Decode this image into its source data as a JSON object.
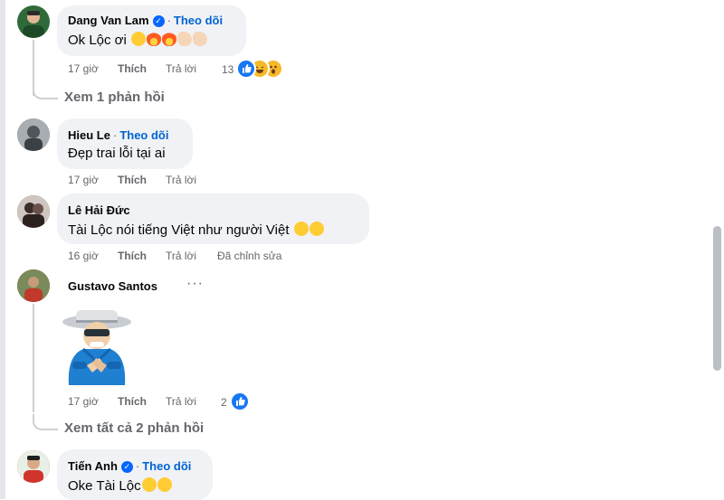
{
  "comments": [
    {
      "name": "Dang Van Lam",
      "verified": true,
      "follow": "Theo dõi",
      "text": "Ok Lộc ơi",
      "emoji_icons": [
        "crazy-face",
        "fire",
        "fire",
        "flexed-arm",
        "flexed-arm"
      ],
      "time": "17 giờ",
      "like_label": "Thích",
      "reply_label": "Trả lời",
      "reaction_count": "13",
      "reaction_icons": [
        "like",
        "haha",
        "wow"
      ],
      "replies_link": "Xem 1 phản hồi",
      "avatar_color": "#2f6b3a"
    },
    {
      "name": "Hieu Le",
      "follow": "Theo dõi",
      "text": "Đẹp trai lỗi tại ai",
      "time": "17 giờ",
      "like_label": "Thích",
      "reply_label": "Trả lời",
      "avatar_color": "#8a8f94"
    },
    {
      "name": "Lê Hải Đức",
      "text": "Tài Lộc nói tiếng Việt như người Việt",
      "emoji_icons": [
        "rolling-laugh",
        "tongue-face"
      ],
      "time": "16 giờ",
      "like_label": "Thích",
      "reply_label": "Trả lời",
      "edited_label": "Đã chỉnh sửa",
      "avatar_color": "#5a4a48"
    },
    {
      "name": "Gustavo Santos",
      "more": "···",
      "sticker": "clapping-old-man-sticker",
      "time": "17 giờ",
      "like_label": "Thích",
      "reply_label": "Trả lời",
      "reaction_count": "2",
      "reaction_icons": [
        "like"
      ],
      "replies_link": "Xem tất cả 2 phản hồi",
      "avatar_color": "#b33a2e"
    },
    {
      "name": "Tiến Anh",
      "verified": true,
      "follow": "Theo dõi",
      "text": "Oke Tài Lộc",
      "emoji_icons": [
        "rolling-laugh",
        "rolling-laugh"
      ],
      "avatar_color": "#c8352b"
    }
  ],
  "colors": {
    "link_blue": "#0064d1",
    "bubble_bg": "#f0f2f5",
    "meta_gray": "#65676b",
    "verified_blue": "#0866ff"
  }
}
